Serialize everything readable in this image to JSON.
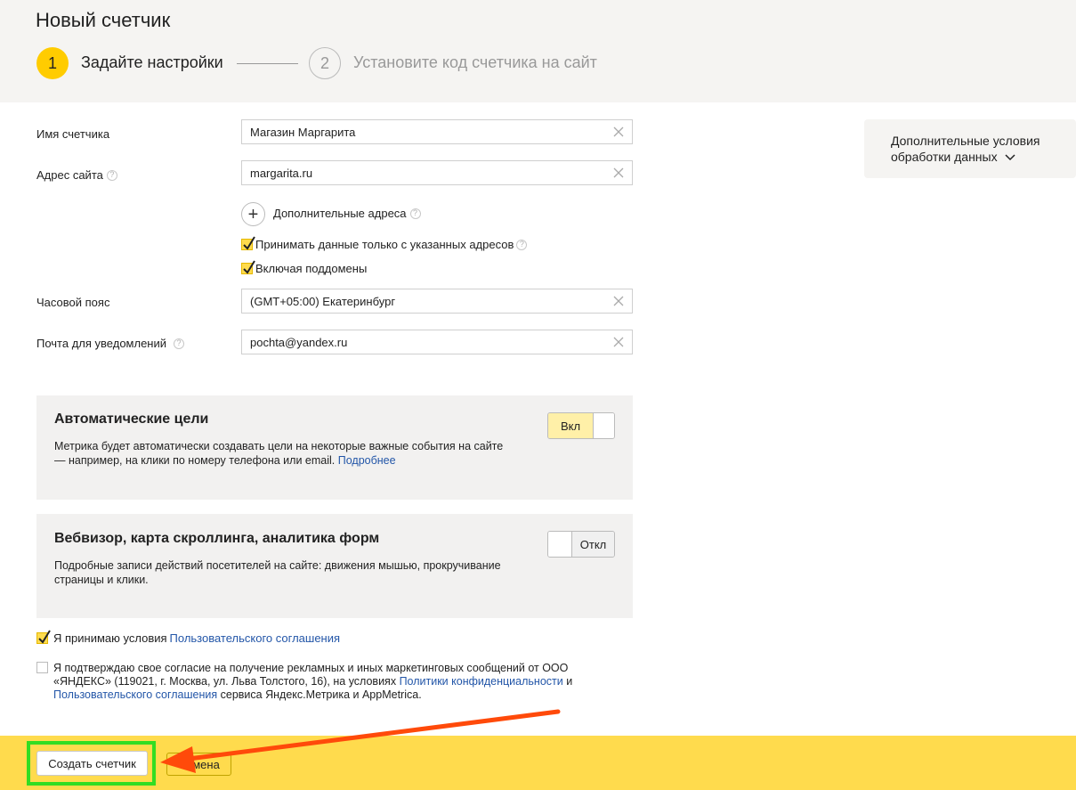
{
  "header": {
    "title": "Новый счетчик",
    "steps": [
      {
        "number": "1",
        "label": "Задайте настройки"
      },
      {
        "number": "2",
        "label": "Установите код счетчика на сайт"
      }
    ]
  },
  "form": {
    "counter_name": {
      "label": "Имя счетчика",
      "value": "Магазин Маргарита"
    },
    "site_address": {
      "label": "Адрес сайта",
      "value": "margarita.ru"
    },
    "additional_addresses_label": "Дополнительные адреса",
    "accept_only_label": "Принимать данные только с указанных адресов",
    "include_subdomains_label": "Включая поддомены",
    "timezone": {
      "label": "Часовой пояс",
      "value": "(GMT+05:00) Екатеринбург"
    },
    "email": {
      "label": "Почта для уведомлений",
      "value": "pochta@yandex.ru"
    }
  },
  "help_glyph": "?",
  "add_glyph": "+",
  "right_panel": {
    "label": "Дополнительные условия обработки данных"
  },
  "auto_goals": {
    "title": "Автоматические цели",
    "desc": "Метрика будет автоматически создавать цели на некоторые важные события на сайте — например, на клики по номеру телефона или email.",
    "link": "Подробнее",
    "toggle_label": "Вкл",
    "enabled": true
  },
  "webvisor": {
    "title": "Вебвизор, карта скроллинга, аналитика форм",
    "desc": "Подробные записи действий посетителей на сайте: движения мышью, прокручивание страницы и клики.",
    "toggle_label": "Откл",
    "enabled": false
  },
  "agreement": {
    "text": "Я принимаю условия",
    "link": "Пользовательского соглашения",
    "checked": true
  },
  "consent": {
    "text_1": "Я подтверждаю свое согласие на получение рекламных и иных маркетинговых сообщений от ООО «ЯНДЕКС» (119021, г. Москва, ул. Льва Толстого, 16), на условиях",
    "link_1": "Политики конфиденциальности",
    "text_2": "и",
    "link_2": "Пользовательского соглашения",
    "text_3": "сервиса Яндекс.Метрика и AppMetrica.",
    "checked": false
  },
  "footer": {
    "create_label": "Создать счетчик",
    "cancel_label": "Отмена"
  },
  "colors": {
    "accent_yellow": "#ffdb4d",
    "link_blue": "#2356a8",
    "annotation_arrow": "#ff4a0a",
    "annotation_highlight": "#33dd22"
  }
}
